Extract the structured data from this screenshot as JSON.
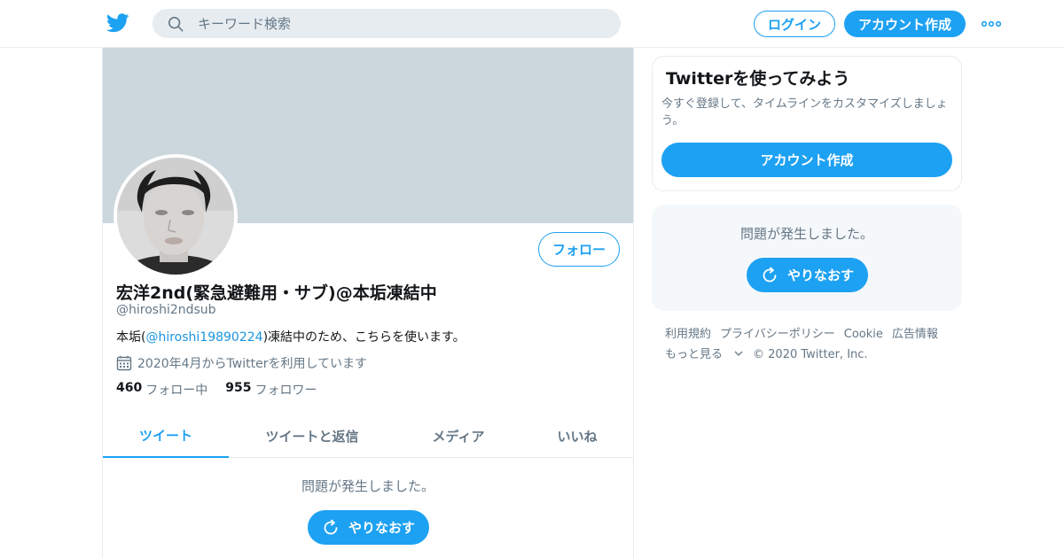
{
  "header": {
    "search_placeholder": "キーワード検索",
    "login_label": "ログイン",
    "signup_label": "アカウント作成"
  },
  "profile": {
    "display_name": "宏洋2nd(緊急避難用・サブ)@本垢凍結中",
    "handle": "@hiroshi2ndsub",
    "bio_prefix": "本垢(",
    "bio_mention": "@hiroshi19890224",
    "bio_suffix": ")凍結中のため、こちらを使います。",
    "joined": "2020年4月からTwitterを利用しています",
    "following_count": "460",
    "following_label": "フォロー中",
    "followers_count": "955",
    "followers_label": "フォロワー",
    "follow_label": "フォロー"
  },
  "tabs": [
    {
      "label": "ツイート",
      "active": true
    },
    {
      "label": "ツイートと返信",
      "active": false
    },
    {
      "label": "メディア",
      "active": false
    },
    {
      "label": "いいね",
      "active": false
    }
  ],
  "main_error": {
    "message": "問題が発生しました。",
    "retry_label": "やりなおす"
  },
  "sidebar": {
    "signup_card": {
      "title": "Twitterを使ってみよう",
      "description": "今すぐ登録して、タイムラインをカスタマイズしましょう。",
      "button_label": "アカウント作成"
    },
    "error_card": {
      "message": "問題が発生しました。",
      "retry_label": "やりなおす"
    },
    "footer": {
      "links": [
        "利用規約",
        "プライバシーポリシー",
        "Cookie",
        "広告情報"
      ],
      "more_label": "もっと見る",
      "copyright": "© 2020 Twitter, Inc."
    }
  },
  "colors": {
    "accent": "#1da1f2",
    "banner": "#ccd6dd",
    "muted_text": "#657786"
  }
}
